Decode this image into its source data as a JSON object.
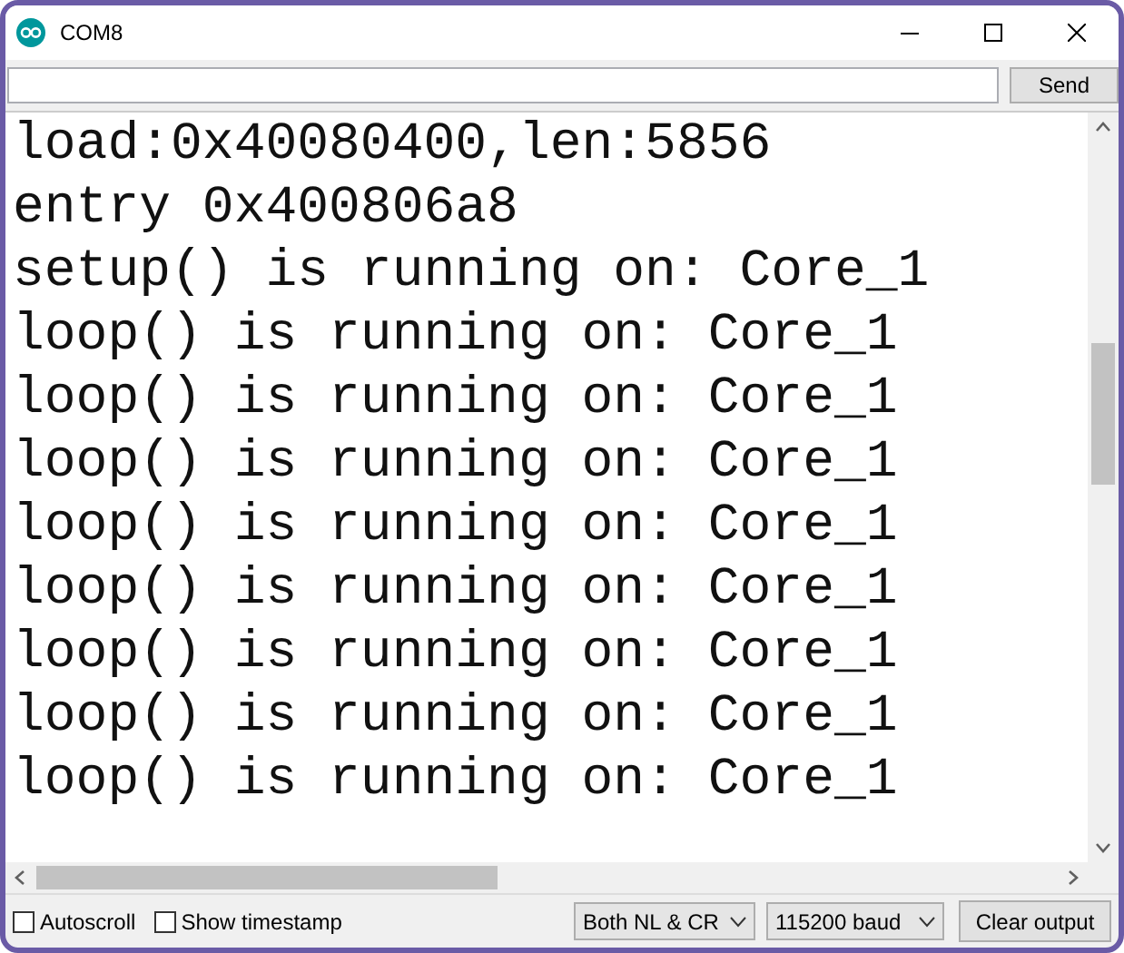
{
  "window": {
    "title": "COM8"
  },
  "send_button": "Send",
  "output_lines": [
    "load:0x40080400,len:5856",
    "entry 0x400806a8",
    "setup() is running on: Core_1",
    "loop() is running on: Core_1",
    "loop() is running on: Core_1",
    "loop() is running on: Core_1",
    "loop() is running on: Core_1",
    "loop() is running on: Core_1",
    "loop() is running on: Core_1",
    "loop() is running on: Core_1",
    "loop() is running on: Core_1"
  ],
  "options": [
    {
      "label": "Autoscroll",
      "checked": false
    },
    {
      "label": "Show timestamp",
      "checked": false
    }
  ],
  "line_ending": "Both NL & CR",
  "baud_rate": "115200 baud",
  "clear_button": "Clear output"
}
